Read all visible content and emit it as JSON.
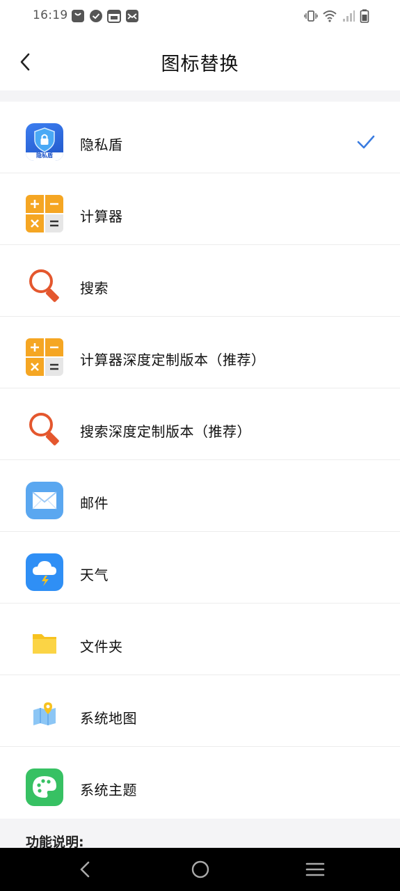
{
  "status_bar": {
    "time": "16:19",
    "left_icons": [
      "shopping-bag-icon",
      "check-circle-icon",
      "calendar-icon",
      "mail-icon"
    ],
    "right_icons": [
      "vibrate-icon",
      "wifi-icon",
      "signal-icon",
      "battery-icon"
    ]
  },
  "header": {
    "title": "图标替换",
    "back_icon": "chevron-left-icon"
  },
  "icons_list": [
    {
      "label": "隐私盾",
      "icon": "privacy-shield-icon",
      "icon_text": "隐私盾",
      "selected": true
    },
    {
      "label": "计算器",
      "icon": "calculator-icon",
      "selected": false
    },
    {
      "label": "搜索",
      "icon": "magnifier-icon",
      "selected": false
    },
    {
      "label": "计算器深度定制版本（推荐）",
      "icon": "calculator-icon",
      "selected": false
    },
    {
      "label": "搜索深度定制版本（推荐）",
      "icon": "magnifier-icon",
      "selected": false
    },
    {
      "label": "邮件",
      "icon": "mail-envelope-icon",
      "selected": false
    },
    {
      "label": "天气",
      "icon": "weather-cloud-icon",
      "selected": false
    },
    {
      "label": "文件夹",
      "icon": "folder-icon",
      "selected": false
    },
    {
      "label": "系统地图",
      "icon": "map-icon",
      "selected": false
    },
    {
      "label": "系统主题",
      "icon": "theme-palette-icon",
      "selected": false
    }
  ],
  "footer": {
    "section_title": "功能说明:"
  },
  "nav_bar": {
    "buttons": [
      "back-triangle-icon",
      "home-circle-icon",
      "menu-lines-icon"
    ]
  },
  "colors": {
    "accent": "#3a7ce0",
    "orange": "#f5a623",
    "search_red": "#e4572e",
    "mail_blue": "#5aa7f0",
    "weather_blue": "#2f8ff5",
    "folder_yellow": "#f7c21f",
    "theme_green": "#37c163"
  }
}
